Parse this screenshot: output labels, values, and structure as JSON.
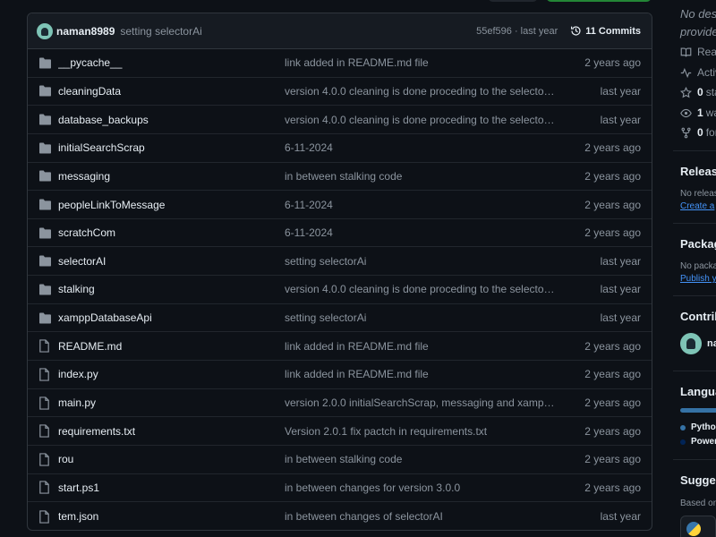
{
  "commit_bar": {
    "author": "naman8989",
    "message": "setting selectorAi",
    "sha_time": "55ef596 · last year",
    "commits_label": "11 Commits"
  },
  "files": [
    {
      "type": "folder",
      "name": "__pycache__",
      "message": "link added in README.md file",
      "date": "2 years ago"
    },
    {
      "type": "folder",
      "name": "cleaningData",
      "message": "version 4.0.0 cleaning is done proceding to the selectorAI ...",
      "date": "last year"
    },
    {
      "type": "folder",
      "name": "database_backups",
      "message": "version 4.0.0 cleaning is done proceding to the selectorAI ...",
      "date": "last year"
    },
    {
      "type": "folder",
      "name": "initialSearchScrap",
      "message": "6-11-2024",
      "date": "2 years ago"
    },
    {
      "type": "folder",
      "name": "messaging",
      "message": "in between stalking code",
      "date": "2 years ago"
    },
    {
      "type": "folder",
      "name": "peopleLinkToMessage",
      "message": "6-11-2024",
      "date": "2 years ago"
    },
    {
      "type": "folder",
      "name": "scratchCom",
      "message": "6-11-2024",
      "date": "2 years ago"
    },
    {
      "type": "folder",
      "name": "selectorAI",
      "message": "setting selectorAi",
      "date": "last year"
    },
    {
      "type": "folder",
      "name": "stalking",
      "message": "version 4.0.0 cleaning is done proceding to the selectorAI ...",
      "date": "last year"
    },
    {
      "type": "folder",
      "name": "xamppDatabaseApi",
      "message": "setting selectorAi",
      "date": "last year"
    },
    {
      "type": "file",
      "name": "README.md",
      "message": "link added in README.md file",
      "date": "2 years ago"
    },
    {
      "type": "file",
      "name": "index.py",
      "message": "link added in README.md file",
      "date": "2 years ago"
    },
    {
      "type": "file",
      "name": "main.py",
      "message": "version 2.0.0 initialSearchScrap, messaging and xamppDa...",
      "date": "2 years ago"
    },
    {
      "type": "file",
      "name": "requirements.txt",
      "message": "Version 2.0.1 fix pactch in requirements.txt",
      "date": "2 years ago"
    },
    {
      "type": "file",
      "name": "rou",
      "message": "in between stalking code",
      "date": "2 years ago"
    },
    {
      "type": "file",
      "name": "start.ps1",
      "message": "in between changes for version 3.0.0",
      "date": "2 years ago"
    },
    {
      "type": "file",
      "name": "tem.json",
      "message": "in between changes of selectorAI",
      "date": "last year"
    }
  ],
  "sidebar": {
    "description_line1": "No desc",
    "description_line2": "provide",
    "readme": "Read",
    "activity": "Activ",
    "stars_count": "0",
    "stars_label": "sta",
    "watching_count": "1",
    "watching_label": "wa",
    "forks_count": "0",
    "forks_label": "for",
    "releases_heading": "Release",
    "releases_text": "No releas",
    "releases_link": "Create a",
    "packages_heading": "Packag",
    "packages_text": "No packa",
    "packages_link": "Publish y",
    "contributors_heading": "Contrib",
    "contributor_name": "na",
    "languages_heading": "Langua",
    "lang1": "Pytho",
    "lang2": "Power",
    "suggested_heading": "Sugges",
    "suggested_text": "Based on"
  },
  "colors": {
    "python": "#3572A5",
    "powershell": "#012456",
    "link": "#4493f8"
  }
}
